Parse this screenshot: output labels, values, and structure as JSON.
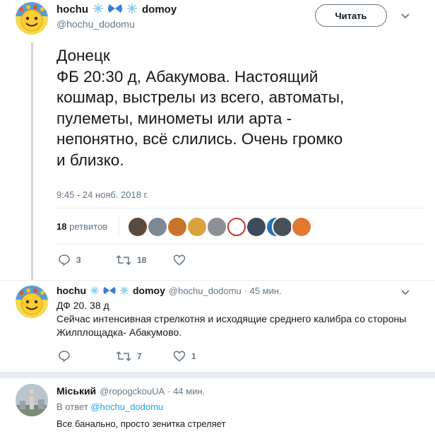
{
  "main_tweet": {
    "name_left": "hochu",
    "name_emojis": "❄️🦋❄️",
    "name_right": "domoy",
    "handle": "@hochu_dodomu",
    "follow_label": "Читать",
    "text_lines": [
      "Донецк",
      "ФБ 20:30 д, Абакумова. Настоящий",
      "кошмар, выстрелы из всего, автоматы,",
      "пулеметы, минометы или арта -",
      "непонятно, всё слились. Очень громко",
      "и близко."
    ],
    "timestamp": "9:45 - 24 нояб. 2018 г.",
    "retweets_count": "18",
    "retweets_label": "ретвитов",
    "replies": "3",
    "retweets": "18",
    "likes": ""
  },
  "reply_1": {
    "name_left": "hochu",
    "name_right": "domoy",
    "handle": "@hochu_dodomu",
    "time": "· 45 мин.",
    "text_line1": "ДФ  20. 38 д",
    "text_line2": "Сейчас интенсивная стрелкотня и исходящие среднего калибра со стороны",
    "text_line3": "Жилплощадка- Абакумово.",
    "replies": "",
    "retweets": "7",
    "likes": "1"
  },
  "reply_2": {
    "name": "Міський",
    "handle": "@ropogckouUA",
    "time": "· 44 мин.",
    "reply_to_prefix": "В ответ",
    "reply_to_handle": "@hochu_dodomu",
    "text": "Все банально, просто зенитка стреляет"
  },
  "colors": {
    "accent": "#1da1f2",
    "muted": "#657786",
    "divider": "#e6ecf0"
  }
}
